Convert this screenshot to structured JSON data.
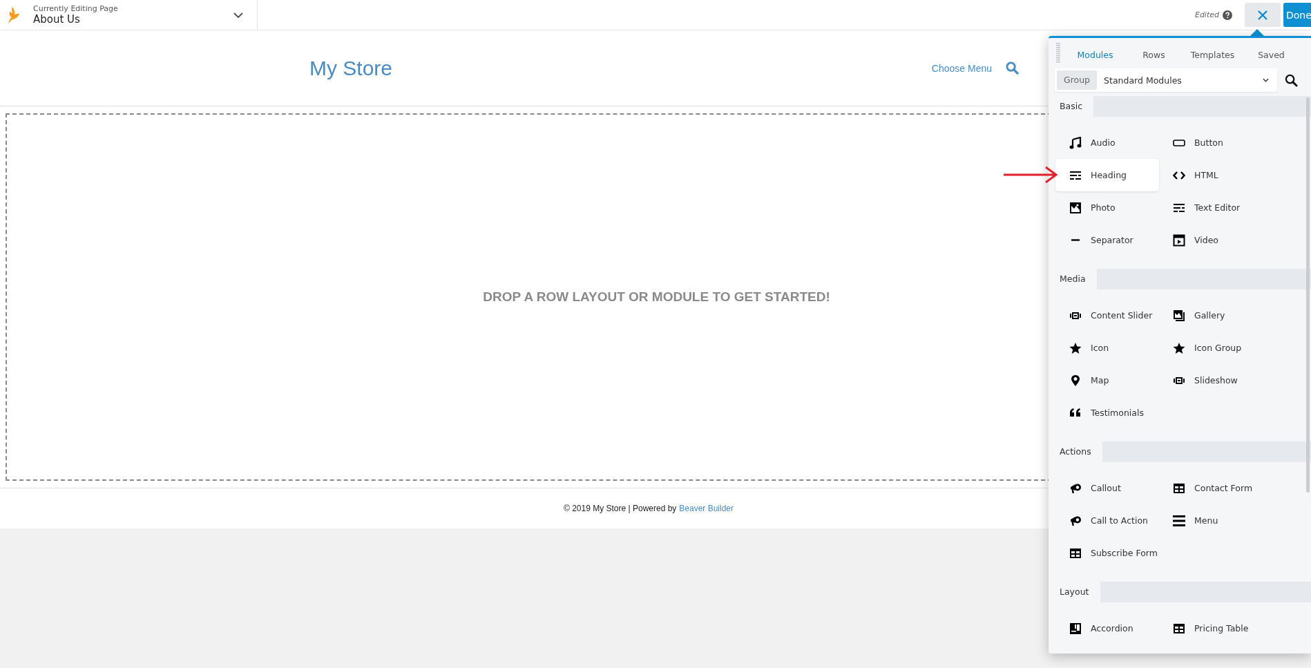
{
  "top_bar": {
    "caption": "Currently Editing Page",
    "page_title": "About Us",
    "status": "Edited",
    "done_label": "Done"
  },
  "site": {
    "title": "My Store",
    "menu_link": "Choose Menu",
    "drop_message": "DROP A ROW LAYOUT OR MODULE TO GET STARTED!",
    "footer_text": "© 2019 My Store | Powered by",
    "footer_link": "Beaver Builder"
  },
  "panel": {
    "tabs": [
      {
        "label": "Modules",
        "selected": true
      },
      {
        "label": "Rows",
        "selected": false
      },
      {
        "label": "Templates",
        "selected": false
      },
      {
        "label": "Saved",
        "selected": false
      }
    ],
    "group_label": "Group",
    "group_value": "Standard Modules",
    "sections": [
      {
        "title": "Basic",
        "items": [
          {
            "label": "Audio",
            "selected": false
          },
          {
            "label": "Button",
            "selected": false
          },
          {
            "label": "Heading",
            "selected": true
          },
          {
            "label": "HTML",
            "selected": false
          },
          {
            "label": "Photo",
            "selected": false
          },
          {
            "label": "Text Editor",
            "selected": false
          },
          {
            "label": "Separator",
            "selected": false
          },
          {
            "label": "Video",
            "selected": false
          }
        ]
      },
      {
        "title": "Media",
        "items": [
          {
            "label": "Content Slider",
            "selected": false
          },
          {
            "label": "Gallery",
            "selected": false
          },
          {
            "label": "Icon",
            "selected": false
          },
          {
            "label": "Icon Group",
            "selected": false
          },
          {
            "label": "Map",
            "selected": false
          },
          {
            "label": "Slideshow",
            "selected": false
          },
          {
            "label": "Testimonials",
            "selected": false
          }
        ]
      },
      {
        "title": "Actions",
        "items": [
          {
            "label": "Callout",
            "selected": false
          },
          {
            "label": "Contact Form",
            "selected": false
          },
          {
            "label": "Call to Action",
            "selected": false
          },
          {
            "label": "Menu",
            "selected": false
          },
          {
            "label": "Subscribe Form",
            "selected": false
          }
        ]
      },
      {
        "title": "Layout",
        "items": [
          {
            "label": "Accordion",
            "selected": false
          },
          {
            "label": "Pricing Table",
            "selected": false
          }
        ]
      }
    ]
  }
}
